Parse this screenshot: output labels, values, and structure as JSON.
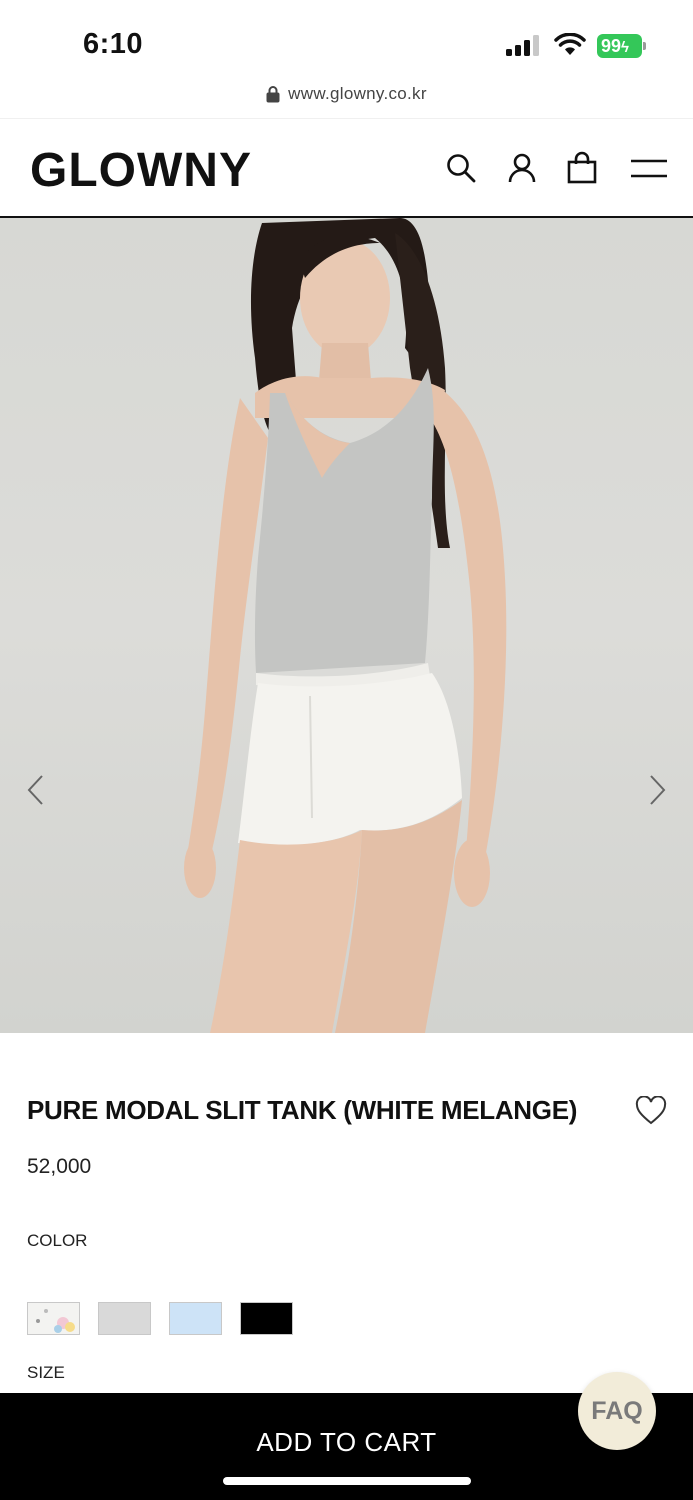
{
  "status_bar": {
    "time": "6:10",
    "battery_level": "99"
  },
  "browser": {
    "url": "www.glowny.co.kr"
  },
  "header": {
    "logo": "GLOWNY",
    "icons": [
      "search-icon",
      "account-icon",
      "shopping-bag-icon",
      "menu-icon"
    ]
  },
  "product": {
    "title": "PURE MODAL SLIT TANK (WHITE MELANGE)",
    "price": "52,000",
    "color_label": "COLOR",
    "size_label": "SIZE",
    "swatches": [
      {
        "name": "pattern",
        "color": "#f3f3f1"
      },
      {
        "name": "grey",
        "color": "#d9d9d9"
      },
      {
        "name": "light-blue",
        "color": "#cde3f7"
      },
      {
        "name": "black",
        "color": "#000000"
      }
    ]
  },
  "actions": {
    "add_to_cart": "ADD TO CART",
    "faq": "FAQ"
  },
  "colors": {
    "battery": "#34c759",
    "cart_bar": "#000000",
    "faq_bg": "#f2ecd9"
  }
}
